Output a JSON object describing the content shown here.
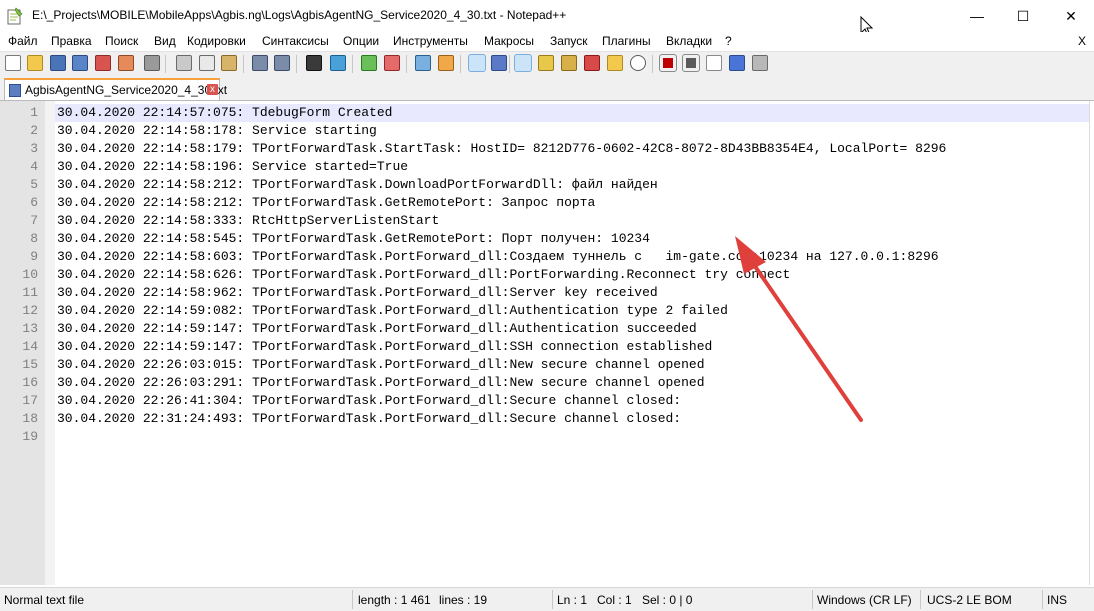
{
  "window": {
    "title": "E:\\_Projects\\MOBILE\\MobileApps\\Agbis.ng\\Logs\\AgbisAgentNG_Service2020_4_30.txt - Notepad++",
    "minimize_glyph": "—",
    "maximize_glyph": "☐",
    "close_glyph": "✕"
  },
  "menu": {
    "items": [
      "Файл",
      "Правка",
      "Поиск",
      "Вид",
      "Кодировки",
      "Синтаксисы",
      "Опции",
      "Инструменты",
      "Макросы",
      "Запуск",
      "Плагины",
      "Вкладки",
      "?"
    ],
    "close_glyph": "X"
  },
  "toolbar": {
    "icons": [
      "new-file-icon",
      "open-file-icon",
      "save-icon",
      "save-all-icon",
      "close-icon",
      "close-all-icon",
      "print-icon",
      "cut-icon",
      "copy-icon",
      "paste-icon",
      "undo-icon",
      "redo-icon",
      "find-icon",
      "replace-icon",
      "zoom-in-icon",
      "zoom-out-icon",
      "sync-vertical-icon",
      "sync-horizontal-icon",
      "word-wrap-icon",
      "show-all-chars-icon",
      "indent-guide-icon",
      "udl-icon",
      "doc-map-icon",
      "function-list-icon",
      "folder-workspace-icon",
      "monitoring-icon",
      "record-macro-icon",
      "stop-macro-icon",
      "play-macro-icon",
      "run-macro-multiple-icon",
      "save-macro-icon"
    ],
    "colors": {
      "active": "#cce4f7",
      "record": "#c00000"
    }
  },
  "tabs": [
    {
      "label": "AgbisAgentNG_Service2020_4_30.txt",
      "close_glyph": "x",
      "accent": "#f7a03e"
    }
  ],
  "editor": {
    "lines": [
      {
        "n": "1",
        "text": "30.04.2020 22:14:57:075: TdebugForm Created"
      },
      {
        "n": "2",
        "text": "30.04.2020 22:14:58:178: Service starting"
      },
      {
        "n": "3",
        "text": "30.04.2020 22:14:58:179: TPortForwardTask.StartTask: HostID= 8212D776-0602-42C8-8072-8D43BB8354E4, LocalPort= 8296"
      },
      {
        "n": "4",
        "text": "30.04.2020 22:14:58:196: Service started=True"
      },
      {
        "n": "5",
        "text": "30.04.2020 22:14:58:212: TPortForwardTask.DownloadPortForwardDll: файл найден"
      },
      {
        "n": "6",
        "text": "30.04.2020 22:14:58:212: TPortForwardTask.GetRemotePort: Запрос порта"
      },
      {
        "n": "7",
        "text": "30.04.2020 22:14:58:333: RtcHttpServerListenStart"
      },
      {
        "n": "8",
        "text": "30.04.2020 22:14:58:545: TPortForwardTask.GetRemotePort: Порт получен: 10234"
      },
      {
        "n": "9",
        "text": "30.04.2020 22:14:58:603: TPortForwardTask.PortForward_dll:Создаем туннель c   im-gate.com:10234 на 127.0.0.1:8296"
      },
      {
        "n": "10",
        "text": "30.04.2020 22:14:58:626: TPortForwardTask.PortForward_dll:PortForwarding.Reconnect try connect"
      },
      {
        "n": "11",
        "text": "30.04.2020 22:14:58:962: TPortForwardTask.PortForward_dll:Server key received"
      },
      {
        "n": "12",
        "text": "30.04.2020 22:14:59:082: TPortForwardTask.PortForward_dll:Authentication type 2 failed"
      },
      {
        "n": "13",
        "text": "30.04.2020 22:14:59:147: TPortForwardTask.PortForward_dll:Authentication succeeded"
      },
      {
        "n": "14",
        "text": "30.04.2020 22:14:59:147: TPortForwardTask.PortForward_dll:SSH connection established"
      },
      {
        "n": "15",
        "text": "30.04.2020 22:26:03:015: TPortForwardTask.PortForward_dll:New secure channel opened"
      },
      {
        "n": "16",
        "text": "30.04.2020 22:26:03:291: TPortForwardTask.PortForward_dll:New secure channel opened"
      },
      {
        "n": "17",
        "text": "30.04.2020 22:26:41:304: TPortForwardTask.PortForward_dll:Secure channel closed:"
      },
      {
        "n": "18",
        "text": "30.04.2020 22:31:24:493: TPortForwardTask.PortForward_dll:Secure channel closed:"
      },
      {
        "n": "19",
        "text": ""
      }
    ],
    "annotation_color": "#e0403c"
  },
  "status": {
    "file_type": "Normal text file",
    "length": "length : 1 461",
    "lines": "lines : 19",
    "ln": "Ln : 1",
    "col": "Col : 1",
    "sel": "Sel : 0 | 0",
    "eol": "Windows (CR LF)",
    "encoding": "UCS-2 LE BOM",
    "mode": "INS"
  }
}
